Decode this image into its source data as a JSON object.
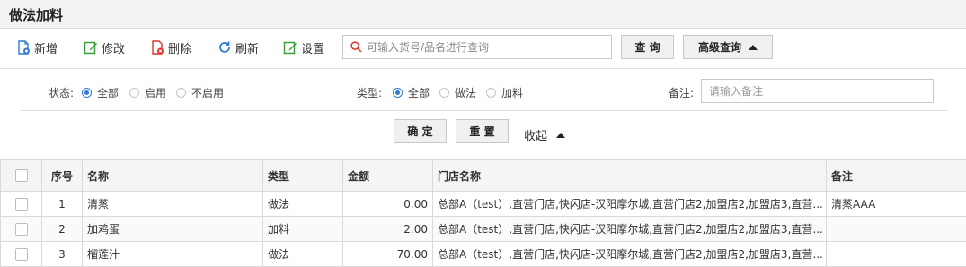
{
  "page": {
    "title": "做法加料"
  },
  "toolbar": {
    "buttons": [
      {
        "label": "新增",
        "icon": "add-file-icon",
        "color": "#2e7bd6"
      },
      {
        "label": "修改",
        "icon": "edit-icon",
        "color": "#3aa13a"
      },
      {
        "label": "删除",
        "icon": "delete-file-icon",
        "color": "#d9342b"
      },
      {
        "label": "刷新",
        "icon": "refresh-icon",
        "color": "#2e7bd6"
      },
      {
        "label": "设置",
        "icon": "settings-edit-icon",
        "color": "#3aa13a"
      }
    ],
    "search_placeholder": "可输入货号/品名进行查询",
    "query_label": "查 询",
    "advanced_label": "高级查询"
  },
  "filters": {
    "status_label": "状态:",
    "status_options": [
      "全部",
      "启用",
      "不启用"
    ],
    "status_selected": "全部",
    "type_label": "类型:",
    "type_options": [
      "全部",
      "做法",
      "加料"
    ],
    "type_selected": "全部",
    "remark_label": "备注:",
    "remark_placeholder": "请输入备注",
    "confirm_label": "确 定",
    "reset_label": "重 置",
    "collapse_label": "收起"
  },
  "table": {
    "headers": [
      "序号",
      "名称",
      "类型",
      "金额",
      "门店名称",
      "备注"
    ],
    "rows": [
      {
        "no": "1",
        "name": "清蒸",
        "type": "做法",
        "amount": "0.00",
        "stores": "总部A（test）,直营门店,快闪店-汉阳摩尔城,直营门店2,加盟店2,加盟店3,直营...",
        "remark": "清蒸AAA"
      },
      {
        "no": "2",
        "name": "加鸡蛋",
        "type": "加料",
        "amount": "2.00",
        "stores": "总部A（test）,直营门店,快闪店-汉阳摩尔城,直营门店2,加盟店2,加盟店3,直营...",
        "remark": ""
      },
      {
        "no": "3",
        "name": "榴莲汁",
        "type": "做法",
        "amount": "70.00",
        "stores": "总部A（test）,直营门店,快闪店-汉阳摩尔城,直营门店2,加盟店2,加盟店3,直营...",
        "remark": ""
      }
    ]
  },
  "colors": {
    "accent": "#2e7bd6",
    "green": "#3aa13a",
    "red": "#d9342b"
  }
}
